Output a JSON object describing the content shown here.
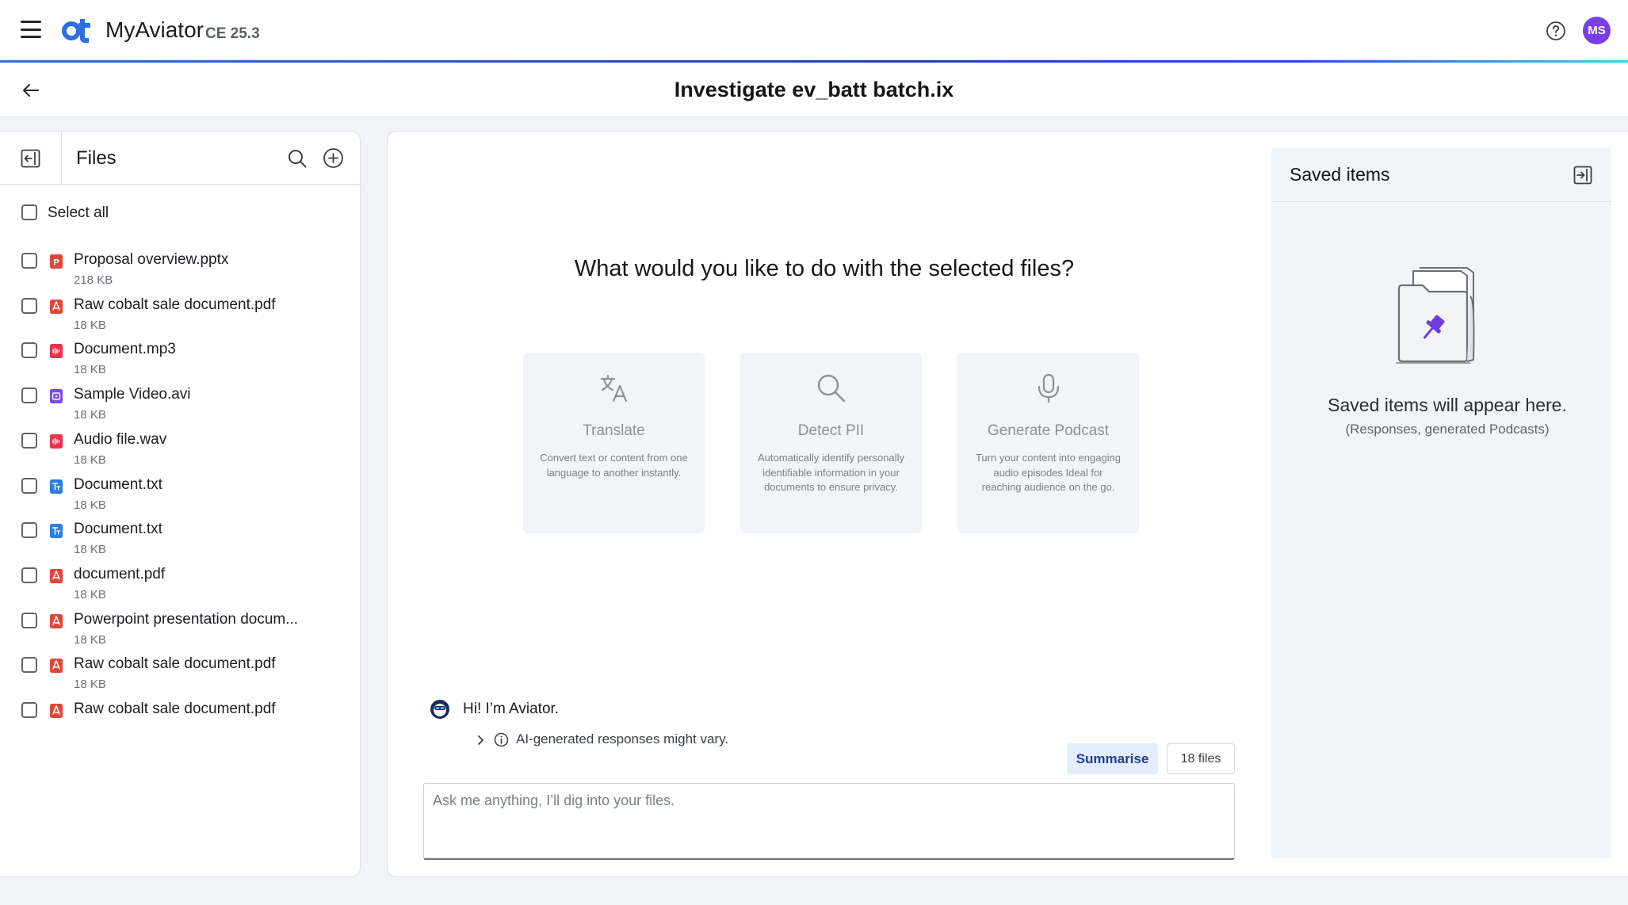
{
  "app": {
    "name": "MyAviator",
    "version": "CE 25.3",
    "user_initials": "MS",
    "accent_color": "#2e6fe0"
  },
  "page": {
    "title": "Investigate ev_batt batch.ix"
  },
  "files_panel": {
    "title": "Files",
    "select_all_label": "Select all",
    "files": [
      {
        "name": "Proposal overview.pptx",
        "size": "218 KB",
        "icon": "pptx-file-icon"
      },
      {
        "name": "Raw cobalt sale document.pdf",
        "size": "18 KB",
        "icon": "pdf-file-icon"
      },
      {
        "name": "Document.mp3",
        "size": "18 KB",
        "icon": "audio-file-icon"
      },
      {
        "name": "Sample Video.avi",
        "size": "18 KB",
        "icon": "video-file-icon"
      },
      {
        "name": "Audio file.wav",
        "size": "18 KB",
        "icon": "audio-file-icon"
      },
      {
        "name": "Document.txt",
        "size": "18 KB",
        "icon": "txt-file-icon"
      },
      {
        "name": "Document.txt",
        "size": "18 KB",
        "icon": "txt-file-icon"
      },
      {
        "name": "document.pdf",
        "size": "18 KB",
        "icon": "pdf-file-icon"
      },
      {
        "name": "Powerpoint presentation docum...",
        "size": "18 KB",
        "icon": "pdf-file-icon"
      },
      {
        "name": "Raw cobalt sale document.pdf",
        "size": "18 KB",
        "icon": "pdf-file-icon"
      },
      {
        "name": "Raw cobalt sale document.pdf",
        "size": "",
        "icon": "pdf-file-icon"
      }
    ]
  },
  "main": {
    "question": "What would you like to do with the selected files?",
    "actions": [
      {
        "title": "Translate",
        "description": "Convert text or content from one language to another instantly.",
        "icon": "translate-icon"
      },
      {
        "title": "Detect PII",
        "description": "Automatically identify personally identifiable information in your documents to ensure privacy.",
        "icon": "search-icon"
      },
      {
        "title": "Generate Podcast",
        "description": "Turn your content into engaging audio episodes Ideal for reaching audience on the go.",
        "icon": "microphone-icon"
      }
    ],
    "chat": {
      "greeting": "Hi! I’m Aviator.",
      "disclaimer": "AI-generated responses might vary.",
      "summarise_label": "Summarise",
      "files_count": "18 files",
      "input_placeholder": "Ask me anything, I’ll dig into your files.",
      "input_value": ""
    }
  },
  "saved_items": {
    "title": "Saved items",
    "empty_title": "Saved items will appear here.",
    "empty_subtitle": "(Responses, generated Podcasts)"
  }
}
